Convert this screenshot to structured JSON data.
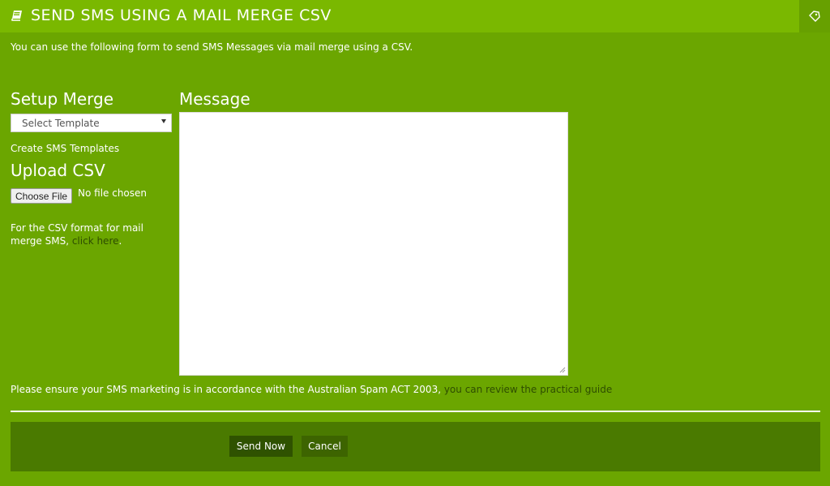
{
  "header": {
    "title": "SEND SMS USING A MAIL MERGE CSV",
    "icon": "book-icon",
    "action_icon": "tag-icon"
  },
  "intro": "You can use the following form to send SMS Messages via mail merge using a CSV.",
  "setup": {
    "title": "Setup Merge",
    "template_select": "Select Template",
    "create_link": "Create SMS Templates"
  },
  "upload": {
    "title": "Upload CSV",
    "choose_button": "Choose File",
    "no_file": "No file chosen",
    "note_prefix": "For the CSV format for mail merge SMS, ",
    "note_link": "click here",
    "note_suffix": "."
  },
  "message": {
    "title": "Message",
    "value": ""
  },
  "notice": {
    "text": "Please ensure your SMS marketing is in accordance with the Australian Spam ACT 2003, ",
    "link": "you can review the practical guide"
  },
  "footer": {
    "send_label": "Send Now",
    "cancel_label": "Cancel"
  },
  "colors": {
    "background": "#6ba600",
    "header": "#7ab800",
    "footer_bar": "#4a7a00",
    "link": "#2e4d00"
  }
}
